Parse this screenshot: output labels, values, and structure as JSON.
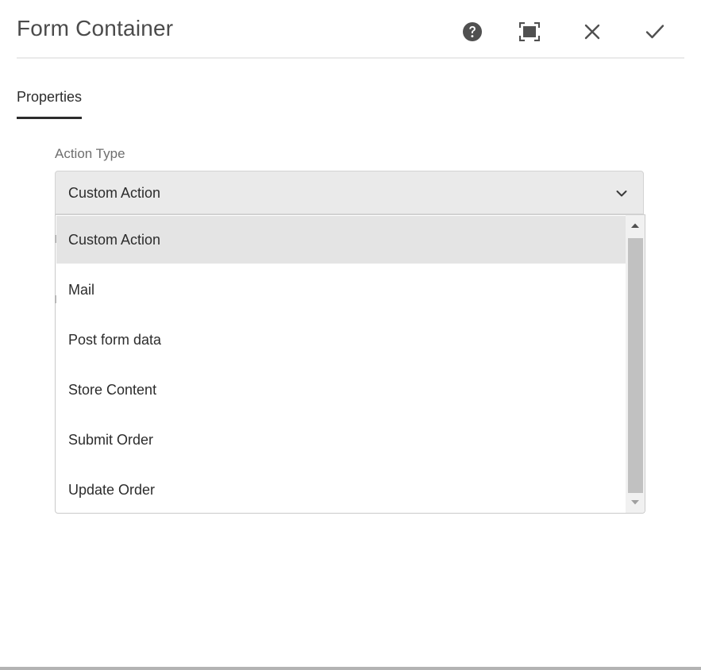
{
  "dialog": {
    "title": "Form Container",
    "buttons": {
      "help_icon": "help-circle-icon",
      "fullscreen_icon": "fullscreen-icon",
      "close_icon": "close-icon",
      "done_icon": "checkmark-icon"
    }
  },
  "tabs": [
    {
      "label": "Properties",
      "active": true
    }
  ],
  "action_type": {
    "label": "Action Type",
    "selected_value": "Custom Action",
    "options": [
      {
        "label": "Custom Action",
        "selected": true
      },
      {
        "label": "Mail",
        "selected": false
      },
      {
        "label": "Post form data",
        "selected": false
      },
      {
        "label": "Store Content",
        "selected": false
      },
      {
        "label": "Submit Order",
        "selected": false
      },
      {
        "label": "Update Order",
        "selected": false
      }
    ]
  },
  "colors": {
    "selected_option_bg": "#e4e4e4",
    "select_bg": "#eaeaea",
    "scroll_thumb": "#c1c1c1",
    "icon_color": "#505050"
  }
}
